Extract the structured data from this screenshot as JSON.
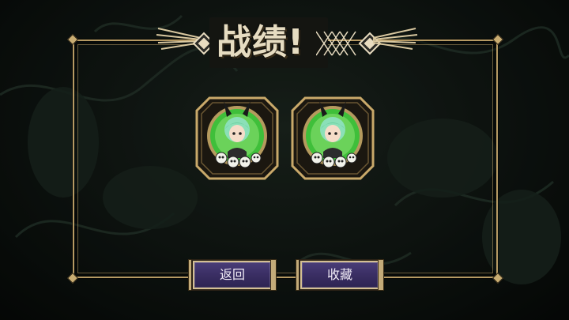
{
  "dialog": {
    "title": "战绩!"
  },
  "medals": [
    {
      "icon": "bunny-ear-girl-portrait-icon",
      "skull_count": 4
    },
    {
      "icon": "bunny-ear-girl-portrait-icon",
      "skull_count": 4
    }
  ],
  "buttons": {
    "back_label": "返回",
    "collect_label": "收藏"
  },
  "colors": {
    "frame_gold": "#b69a63",
    "medal_green": "#3fbf3a",
    "button_purple": "#3a2e63",
    "title_text": "#e6dcc1"
  }
}
